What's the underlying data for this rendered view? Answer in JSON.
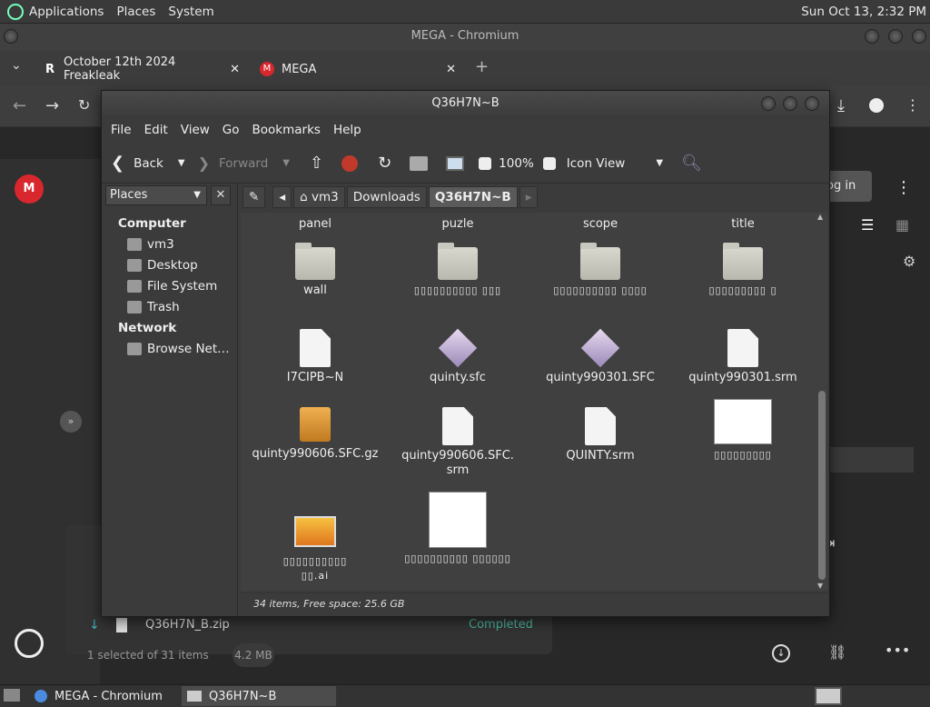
{
  "topbar": {
    "applications": "Applications",
    "places": "Places",
    "system": "System",
    "clock": "Sun Oct 13,  2:32 PM"
  },
  "chromium": {
    "title": "MEGA - Chromium",
    "tabs": [
      {
        "label": "October 12th 2024 Freakleak"
      },
      {
        "label": "MEGA"
      }
    ],
    "new_tab": "+",
    "login": "og in",
    "download_name": "Q36H7N_B.zip",
    "download_status": "Completed",
    "selection": "1 selected of 31 items",
    "selection_size": "4.2 MB"
  },
  "fm": {
    "title": "Q36H7N~B",
    "menu": [
      "File",
      "Edit",
      "View",
      "Go",
      "Bookmarks",
      "Help"
    ],
    "toolbar": {
      "back": "Back",
      "forward": "Forward",
      "zoom": "100%",
      "view_mode": "Icon View"
    },
    "places_label": "Places",
    "sidebar": {
      "computer": "Computer",
      "computer_items": [
        "vm3",
        "Desktop",
        "File System",
        "Trash"
      ],
      "network": "Network",
      "network_items": [
        "Browse Net…"
      ]
    },
    "path": [
      "vm3",
      "Downloads",
      "Q36H7N~B"
    ],
    "header_row": [
      "panel",
      "puzle",
      "scope",
      "title"
    ],
    "items": [
      {
        "name": "wall",
        "type": "folder"
      },
      {
        "name": "▯▯▯▯▯▯▯▯▯▯ ▯▯▯",
        "type": "folder"
      },
      {
        "name": "▯▯▯▯▯▯▯▯▯▯ ▯▯▯▯",
        "type": "folder"
      },
      {
        "name": "▯▯▯▯▯▯▯▯▯ ▯",
        "type": "folder"
      },
      {
        "name": "I7CIPB~N",
        "type": "file"
      },
      {
        "name": "quinty.sfc",
        "type": "rom"
      },
      {
        "name": "quinty990301.SFC",
        "type": "rom"
      },
      {
        "name": "quinty990301.srm",
        "type": "file"
      },
      {
        "name": "quinty990606.SFC.gz",
        "type": "archive"
      },
      {
        "name": "quinty990606.SFC.\nsrm",
        "type": "file"
      },
      {
        "name": "QUINTY.srm",
        "type": "file"
      },
      {
        "name": "▯▯▯▯▯▯▯▯▯",
        "type": "image"
      },
      {
        "name": "▯▯▯▯▯▯▯▯▯▯\n▯▯.ai",
        "type": "picture"
      },
      {
        "name": "▯▯▯▯▯▯▯▯▯▯ ▯▯▯▯▯▯",
        "type": "image"
      }
    ],
    "status": "34 items, Free space: 25.6 GB"
  },
  "taskbar": {
    "items": [
      "MEGA - Chromium",
      "Q36H7N~B"
    ]
  }
}
